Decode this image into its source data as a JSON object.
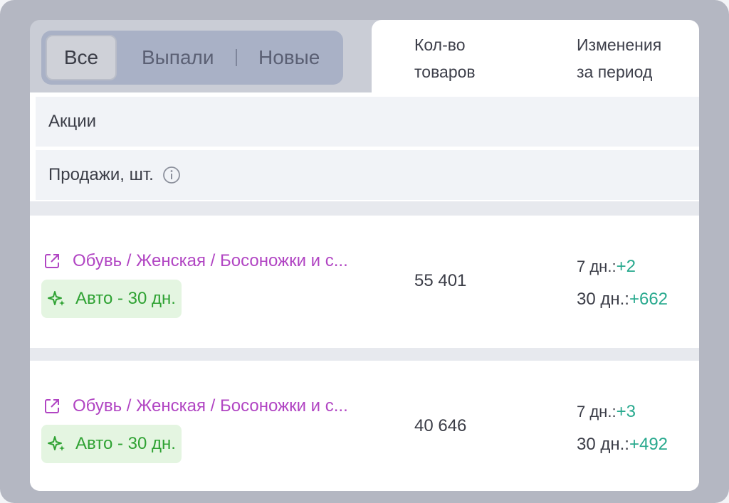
{
  "tabs": [
    {
      "label": "Все",
      "active": true
    },
    {
      "label": "Выпали",
      "active": false
    },
    {
      "label": "Новые",
      "active": false
    }
  ],
  "columns": {
    "qty": "Кол-во\nтоваров",
    "changes": "Изменения\nза период"
  },
  "sections": {
    "promo_label": "Акции",
    "sales_label": "Продажи, шт."
  },
  "rows": [
    {
      "category": "Обувь / Женская / Босоножки и с...",
      "badge": "Авто - 30 дн.",
      "qty": "55 401",
      "change_7_label": "7 дн.:",
      "change_7_value": "+2",
      "change_30_label": "30 дн.:",
      "change_30_value": "+662"
    },
    {
      "category": "Обувь / Женская / Босоножки и с...",
      "badge": "Авто - 30 дн.",
      "qty": "40 646",
      "change_7_label": "7 дн.:",
      "change_7_value": "+3",
      "change_30_label": "30 дн.:",
      "change_30_value": "+492"
    }
  ],
  "colors": {
    "link": "#b145c3",
    "badge_text": "#2fa233",
    "badge_bg": "#e4f5e1",
    "delta": "#28a98e"
  },
  "icons": {
    "external_link": "external-link-icon",
    "sparkle": "sparkle-icon",
    "info": "info-icon"
  }
}
